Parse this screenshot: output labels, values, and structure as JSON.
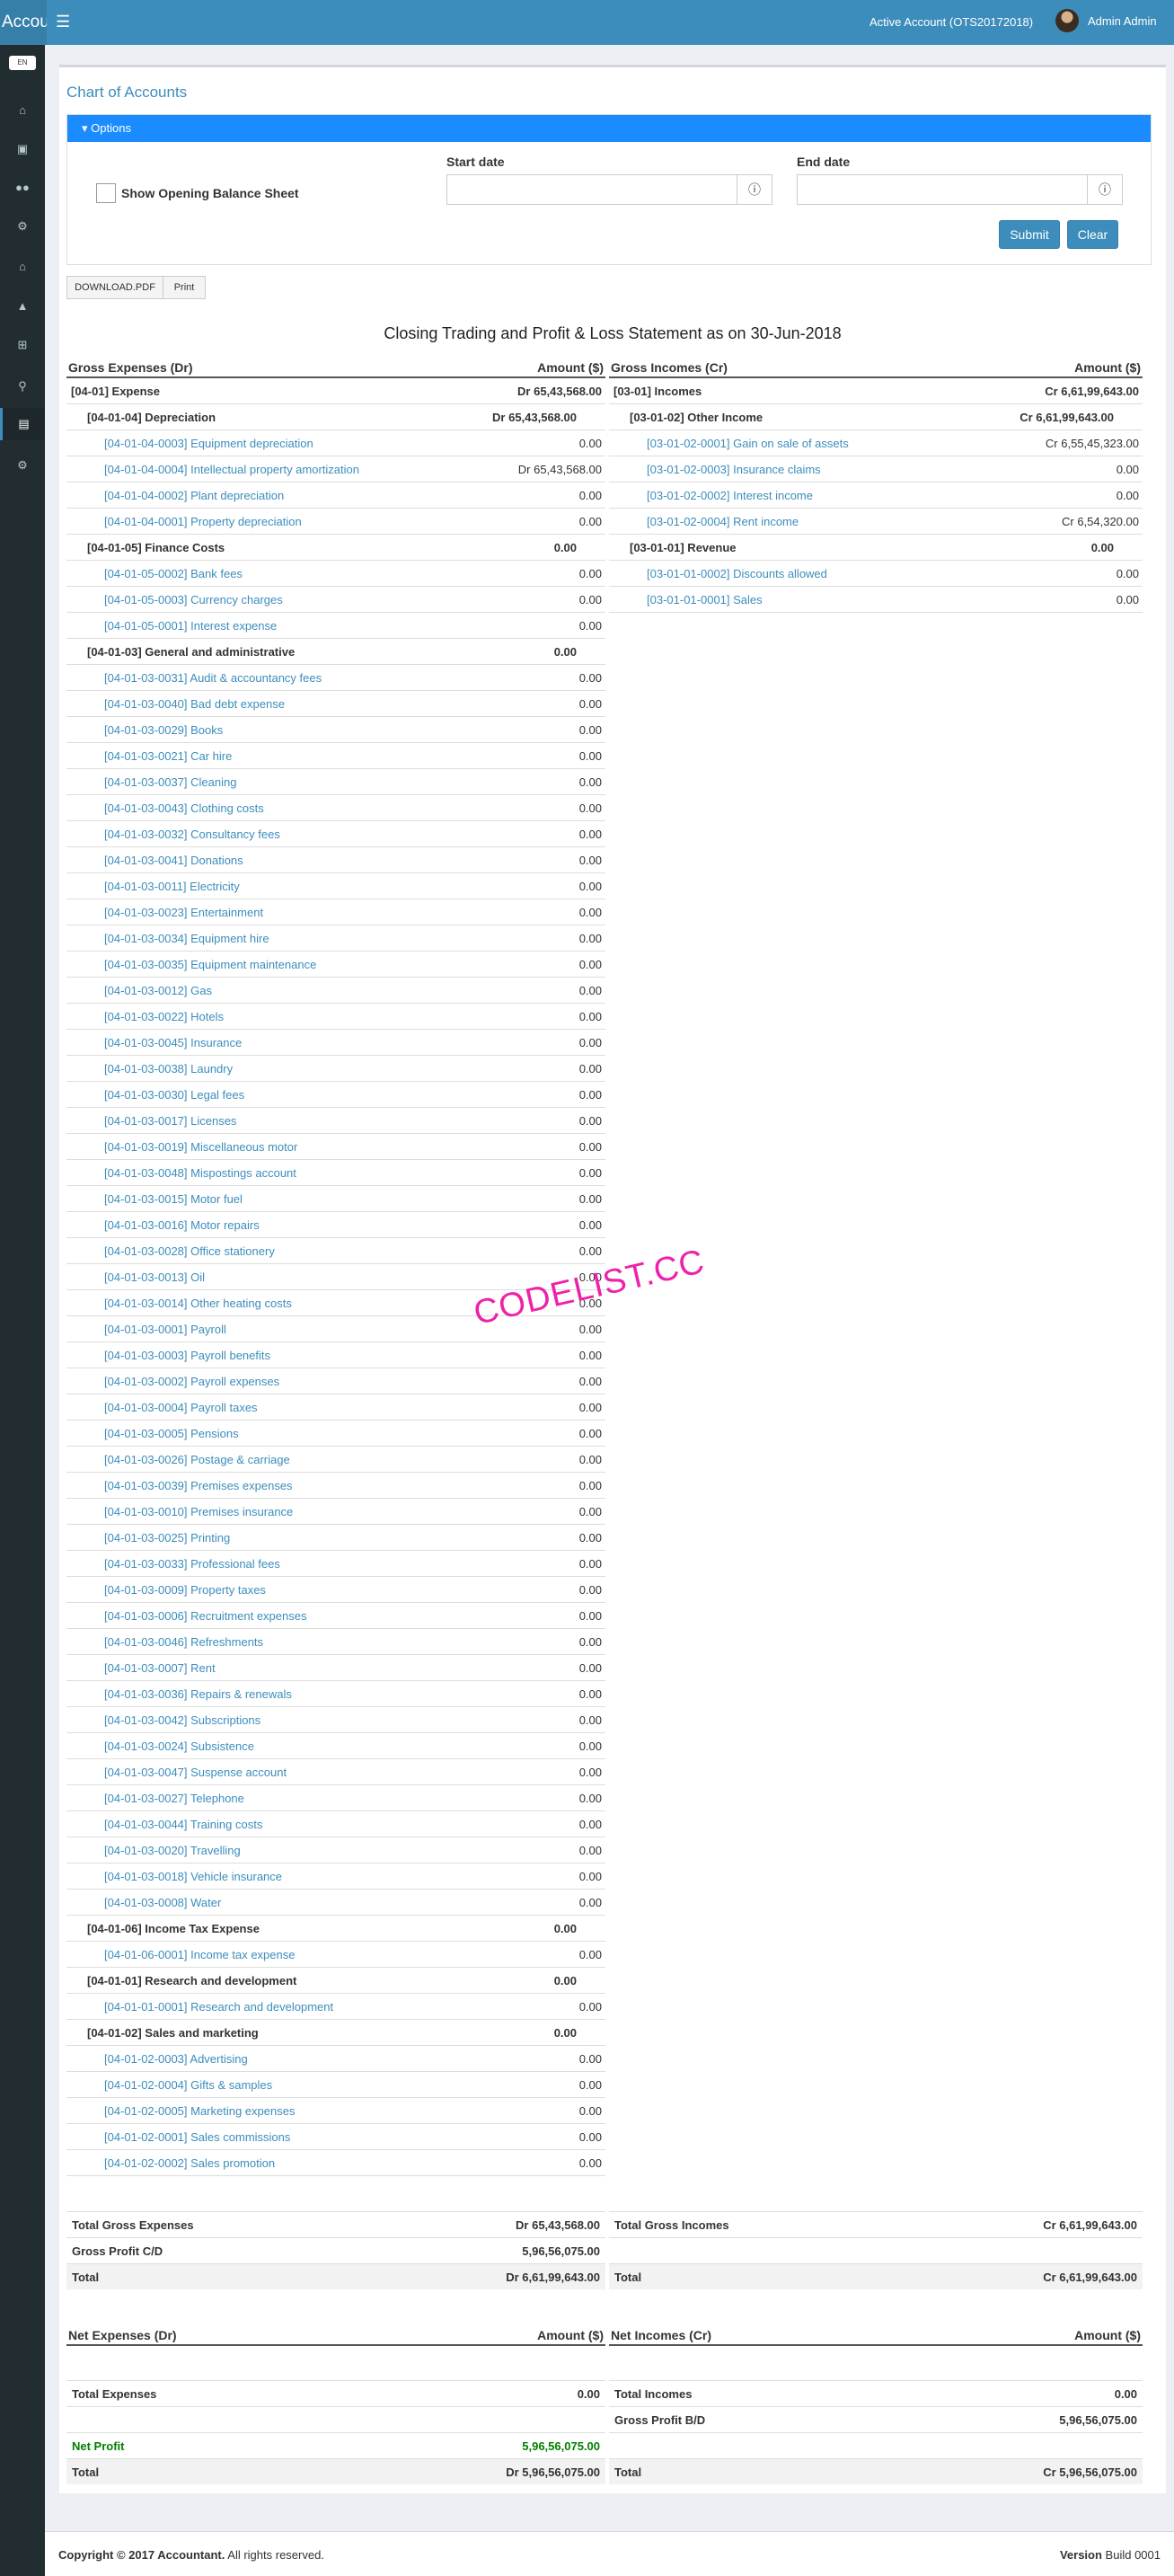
{
  "header": {
    "brand": "Accou",
    "account": "Active Account (OTS20172018)",
    "user": "Admin Admin"
  },
  "sidebar": {
    "lang": "EN",
    "icons": [
      "home-icon",
      "book-icon",
      "users-icon",
      "gears-icon",
      "home2-icon",
      "sitemap-icon",
      "plus-square-icon",
      "search-icon",
      "chart-icon",
      "gear-icon"
    ]
  },
  "page": {
    "title": "Chart of Accounts",
    "options_label": "Options",
    "show_opening": "Show Opening Balance Sheet",
    "start_label": "Start date",
    "end_label": "End date",
    "submit": "Submit",
    "clear": "Clear",
    "download": "DOWNLOAD.PDF",
    "print": "Print",
    "report_title": "Closing Trading and Profit & Loss Statement as on 30-Jun-2018"
  },
  "expenses": {
    "head_left": "Gross Expenses (Dr)",
    "head_right": "Amount ($)",
    "rows": [
      {
        "l": 0,
        "name": "[04-01] Expense",
        "amt": "Dr 65,43,568.00"
      },
      {
        "l": 1,
        "name": "[04-01-04] Depreciation",
        "amt": "Dr 65,43,568.00"
      },
      {
        "l": 2,
        "name": "[04-01-04-0003] Equipment depreciation",
        "amt": "0.00"
      },
      {
        "l": 2,
        "name": "[04-01-04-0004] Intellectual property amortization",
        "amt": "Dr 65,43,568.00"
      },
      {
        "l": 2,
        "name": "[04-01-04-0002] Plant depreciation",
        "amt": "0.00"
      },
      {
        "l": 2,
        "name": "[04-01-04-0001] Property depreciation",
        "amt": "0.00"
      },
      {
        "l": 1,
        "name": "[04-01-05] Finance Costs",
        "amt": "0.00"
      },
      {
        "l": 2,
        "name": "[04-01-05-0002] Bank fees",
        "amt": "0.00"
      },
      {
        "l": 2,
        "name": "[04-01-05-0003] Currency charges",
        "amt": "0.00"
      },
      {
        "l": 2,
        "name": "[04-01-05-0001] Interest expense",
        "amt": "0.00"
      },
      {
        "l": 1,
        "name": "[04-01-03] General and administrative",
        "amt": "0.00"
      },
      {
        "l": 2,
        "name": "[04-01-03-0031] Audit & accountancy fees",
        "amt": "0.00"
      },
      {
        "l": 2,
        "name": "[04-01-03-0040] Bad debt expense",
        "amt": "0.00"
      },
      {
        "l": 2,
        "name": "[04-01-03-0029] Books",
        "amt": "0.00"
      },
      {
        "l": 2,
        "name": "[04-01-03-0021] Car hire",
        "amt": "0.00"
      },
      {
        "l": 2,
        "name": "[04-01-03-0037] Cleaning",
        "amt": "0.00"
      },
      {
        "l": 2,
        "name": "[04-01-03-0043] Clothing costs",
        "amt": "0.00"
      },
      {
        "l": 2,
        "name": "[04-01-03-0032] Consultancy fees",
        "amt": "0.00"
      },
      {
        "l": 2,
        "name": "[04-01-03-0041] Donations",
        "amt": "0.00"
      },
      {
        "l": 2,
        "name": "[04-01-03-0011] Electricity",
        "amt": "0.00"
      },
      {
        "l": 2,
        "name": "[04-01-03-0023] Entertainment",
        "amt": "0.00"
      },
      {
        "l": 2,
        "name": "[04-01-03-0034] Equipment hire",
        "amt": "0.00"
      },
      {
        "l": 2,
        "name": "[04-01-03-0035] Equipment maintenance",
        "amt": "0.00"
      },
      {
        "l": 2,
        "name": "[04-01-03-0012] Gas",
        "amt": "0.00"
      },
      {
        "l": 2,
        "name": "[04-01-03-0022] Hotels",
        "amt": "0.00"
      },
      {
        "l": 2,
        "name": "[04-01-03-0045] Insurance",
        "amt": "0.00"
      },
      {
        "l": 2,
        "name": "[04-01-03-0038] Laundry",
        "amt": "0.00"
      },
      {
        "l": 2,
        "name": "[04-01-03-0030] Legal fees",
        "amt": "0.00"
      },
      {
        "l": 2,
        "name": "[04-01-03-0017] Licenses",
        "amt": "0.00"
      },
      {
        "l": 2,
        "name": "[04-01-03-0019] Miscellaneous motor",
        "amt": "0.00"
      },
      {
        "l": 2,
        "name": "[04-01-03-0048] Mispostings account",
        "amt": "0.00"
      },
      {
        "l": 2,
        "name": "[04-01-03-0015] Motor fuel",
        "amt": "0.00"
      },
      {
        "l": 2,
        "name": "[04-01-03-0016] Motor repairs",
        "amt": "0.00"
      },
      {
        "l": 2,
        "name": "[04-01-03-0028] Office stationery",
        "amt": "0.00"
      },
      {
        "l": 2,
        "name": "[04-01-03-0013] Oil",
        "amt": "0.00"
      },
      {
        "l": 2,
        "name": "[04-01-03-0014] Other heating costs",
        "amt": "0.00"
      },
      {
        "l": 2,
        "name": "[04-01-03-0001] Payroll",
        "amt": "0.00"
      },
      {
        "l": 2,
        "name": "[04-01-03-0003] Payroll benefits",
        "amt": "0.00"
      },
      {
        "l": 2,
        "name": "[04-01-03-0002] Payroll expenses",
        "amt": "0.00"
      },
      {
        "l": 2,
        "name": "[04-01-03-0004] Payroll taxes",
        "amt": "0.00"
      },
      {
        "l": 2,
        "name": "[04-01-03-0005] Pensions",
        "amt": "0.00"
      },
      {
        "l": 2,
        "name": "[04-01-03-0026] Postage & carriage",
        "amt": "0.00"
      },
      {
        "l": 2,
        "name": "[04-01-03-0039] Premises expenses",
        "amt": "0.00"
      },
      {
        "l": 2,
        "name": "[04-01-03-0010] Premises insurance",
        "amt": "0.00"
      },
      {
        "l": 2,
        "name": "[04-01-03-0025] Printing",
        "amt": "0.00"
      },
      {
        "l": 2,
        "name": "[04-01-03-0033] Professional fees",
        "amt": "0.00"
      },
      {
        "l": 2,
        "name": "[04-01-03-0009] Property taxes",
        "amt": "0.00"
      },
      {
        "l": 2,
        "name": "[04-01-03-0006] Recruitment expenses",
        "amt": "0.00"
      },
      {
        "l": 2,
        "name": "[04-01-03-0046] Refreshments",
        "amt": "0.00"
      },
      {
        "l": 2,
        "name": "[04-01-03-0007] Rent",
        "amt": "0.00"
      },
      {
        "l": 2,
        "name": "[04-01-03-0036] Repairs & renewals",
        "amt": "0.00"
      },
      {
        "l": 2,
        "name": "[04-01-03-0042] Subscriptions",
        "amt": "0.00"
      },
      {
        "l": 2,
        "name": "[04-01-03-0024] Subsistence",
        "amt": "0.00"
      },
      {
        "l": 2,
        "name": "[04-01-03-0047] Suspense account",
        "amt": "0.00"
      },
      {
        "l": 2,
        "name": "[04-01-03-0027] Telephone",
        "amt": "0.00"
      },
      {
        "l": 2,
        "name": "[04-01-03-0044] Training costs",
        "amt": "0.00"
      },
      {
        "l": 2,
        "name": "[04-01-03-0020] Travelling",
        "amt": "0.00"
      },
      {
        "l": 2,
        "name": "[04-01-03-0018] Vehicle insurance",
        "amt": "0.00"
      },
      {
        "l": 2,
        "name": "[04-01-03-0008] Water",
        "amt": "0.00"
      },
      {
        "l": 1,
        "name": "[04-01-06] Income Tax Expense",
        "amt": "0.00"
      },
      {
        "l": 2,
        "name": "[04-01-06-0001] Income tax expense",
        "amt": "0.00"
      },
      {
        "l": 1,
        "name": "[04-01-01] Research and development",
        "amt": "0.00"
      },
      {
        "l": 2,
        "name": "[04-01-01-0001] Research and development",
        "amt": "0.00"
      },
      {
        "l": 1,
        "name": "[04-01-02] Sales and marketing",
        "amt": "0.00"
      },
      {
        "l": 2,
        "name": "[04-01-02-0003] Advertising",
        "amt": "0.00"
      },
      {
        "l": 2,
        "name": "[04-01-02-0004] Gifts & samples",
        "amt": "0.00"
      },
      {
        "l": 2,
        "name": "[04-01-02-0005] Marketing expenses",
        "amt": "0.00"
      },
      {
        "l": 2,
        "name": "[04-01-02-0001] Sales commissions",
        "amt": "0.00"
      },
      {
        "l": 2,
        "name": "[04-01-02-0002] Sales promotion",
        "amt": "0.00"
      }
    ],
    "totals": [
      {
        "name": "Total Gross Expenses",
        "amt": "Dr 65,43,568.00"
      },
      {
        "name": "Gross Profit C/D",
        "amt": "5,96,56,075.00"
      },
      {
        "name": "Total",
        "amt": "Dr 6,61,99,643.00"
      }
    ]
  },
  "incomes": {
    "head_left": "Gross Incomes (Cr)",
    "head_right": "Amount ($)",
    "rows": [
      {
        "l": 0,
        "name": "[03-01] Incomes",
        "amt": "Cr 6,61,99,643.00"
      },
      {
        "l": 1,
        "name": "[03-01-02] Other Income",
        "amt": "Cr 6,61,99,643.00"
      },
      {
        "l": 2,
        "name": "[03-01-02-0001] Gain on sale of assets",
        "amt": "Cr 6,55,45,323.00"
      },
      {
        "l": 2,
        "name": "[03-01-02-0003] Insurance claims",
        "amt": "0.00"
      },
      {
        "l": 2,
        "name": "[03-01-02-0002] Interest income",
        "amt": "0.00"
      },
      {
        "l": 2,
        "name": "[03-01-02-0004] Rent income",
        "amt": "Cr 6,54,320.00"
      },
      {
        "l": 1,
        "name": "[03-01-01] Revenue",
        "amt": "0.00"
      },
      {
        "l": 2,
        "name": "[03-01-01-0002] Discounts allowed",
        "amt": "0.00"
      },
      {
        "l": 2,
        "name": "[03-01-01-0001] Sales",
        "amt": "0.00"
      }
    ],
    "totals": [
      {
        "name": "Total Gross Incomes",
        "amt": "Cr 6,61,99,643.00"
      },
      {
        "name": "",
        "amt": ""
      },
      {
        "name": "Total",
        "amt": "Cr 6,61,99,643.00"
      }
    ]
  },
  "net": {
    "exp_head": "Net Expenses (Dr)",
    "inc_head": "Net Incomes (Cr)",
    "amount_head": "Amount ($)",
    "total_expenses": "Total Expenses",
    "total_expenses_amt": "0.00",
    "net_profit": "Net Profit",
    "net_profit_amt": "5,96,56,075.00",
    "left_total": "Total",
    "left_total_amt": "Dr 5,96,56,075.00",
    "total_incomes": "Total Incomes",
    "total_incomes_amt": "0.00",
    "gp_bd": "Gross Profit B/D",
    "gp_bd_amt": "5,96,56,075.00",
    "right_total": "Total",
    "right_total_amt": "Cr 5,96,56,075.00"
  },
  "watermark": "CODELIST.CC",
  "footer": {
    "copyright": "Copyright © 2017",
    "company": "Accountant.",
    "rights": "All rights reserved.",
    "version_label": "Version",
    "build": "Build 0001"
  }
}
